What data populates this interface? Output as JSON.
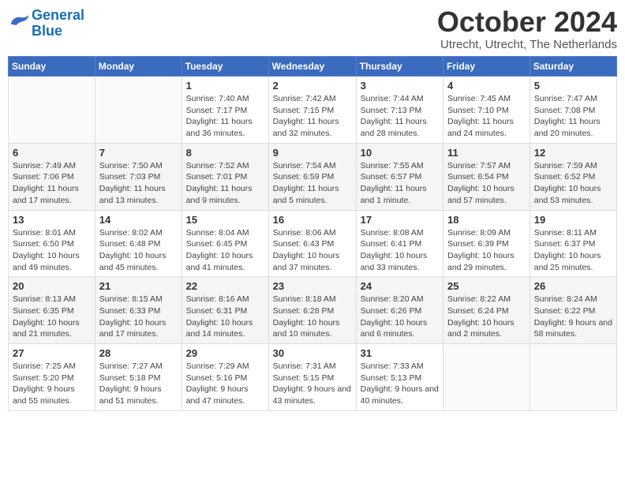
{
  "header": {
    "logo_line1": "General",
    "logo_line2": "Blue",
    "month": "October 2024",
    "location": "Utrecht, Utrecht, The Netherlands"
  },
  "days_of_week": [
    "Sunday",
    "Monday",
    "Tuesday",
    "Wednesday",
    "Thursday",
    "Friday",
    "Saturday"
  ],
  "weeks": [
    [
      {
        "num": "",
        "detail": ""
      },
      {
        "num": "",
        "detail": ""
      },
      {
        "num": "1",
        "detail": "Sunrise: 7:40 AM\nSunset: 7:17 PM\nDaylight: 11 hours and 36 minutes."
      },
      {
        "num": "2",
        "detail": "Sunrise: 7:42 AM\nSunset: 7:15 PM\nDaylight: 11 hours and 32 minutes."
      },
      {
        "num": "3",
        "detail": "Sunrise: 7:44 AM\nSunset: 7:13 PM\nDaylight: 11 hours and 28 minutes."
      },
      {
        "num": "4",
        "detail": "Sunrise: 7:45 AM\nSunset: 7:10 PM\nDaylight: 11 hours and 24 minutes."
      },
      {
        "num": "5",
        "detail": "Sunrise: 7:47 AM\nSunset: 7:08 PM\nDaylight: 11 hours and 20 minutes."
      }
    ],
    [
      {
        "num": "6",
        "detail": "Sunrise: 7:49 AM\nSunset: 7:06 PM\nDaylight: 11 hours and 17 minutes."
      },
      {
        "num": "7",
        "detail": "Sunrise: 7:50 AM\nSunset: 7:03 PM\nDaylight: 11 hours and 13 minutes."
      },
      {
        "num": "8",
        "detail": "Sunrise: 7:52 AM\nSunset: 7:01 PM\nDaylight: 11 hours and 9 minutes."
      },
      {
        "num": "9",
        "detail": "Sunrise: 7:54 AM\nSunset: 6:59 PM\nDaylight: 11 hours and 5 minutes."
      },
      {
        "num": "10",
        "detail": "Sunrise: 7:55 AM\nSunset: 6:57 PM\nDaylight: 11 hours and 1 minute."
      },
      {
        "num": "11",
        "detail": "Sunrise: 7:57 AM\nSunset: 6:54 PM\nDaylight: 10 hours and 57 minutes."
      },
      {
        "num": "12",
        "detail": "Sunrise: 7:59 AM\nSunset: 6:52 PM\nDaylight: 10 hours and 53 minutes."
      }
    ],
    [
      {
        "num": "13",
        "detail": "Sunrise: 8:01 AM\nSunset: 6:50 PM\nDaylight: 10 hours and 49 minutes."
      },
      {
        "num": "14",
        "detail": "Sunrise: 8:02 AM\nSunset: 6:48 PM\nDaylight: 10 hours and 45 minutes."
      },
      {
        "num": "15",
        "detail": "Sunrise: 8:04 AM\nSunset: 6:45 PM\nDaylight: 10 hours and 41 minutes."
      },
      {
        "num": "16",
        "detail": "Sunrise: 8:06 AM\nSunset: 6:43 PM\nDaylight: 10 hours and 37 minutes."
      },
      {
        "num": "17",
        "detail": "Sunrise: 8:08 AM\nSunset: 6:41 PM\nDaylight: 10 hours and 33 minutes."
      },
      {
        "num": "18",
        "detail": "Sunrise: 8:09 AM\nSunset: 6:39 PM\nDaylight: 10 hours and 29 minutes."
      },
      {
        "num": "19",
        "detail": "Sunrise: 8:11 AM\nSunset: 6:37 PM\nDaylight: 10 hours and 25 minutes."
      }
    ],
    [
      {
        "num": "20",
        "detail": "Sunrise: 8:13 AM\nSunset: 6:35 PM\nDaylight: 10 hours and 21 minutes."
      },
      {
        "num": "21",
        "detail": "Sunrise: 8:15 AM\nSunset: 6:33 PM\nDaylight: 10 hours and 17 minutes."
      },
      {
        "num": "22",
        "detail": "Sunrise: 8:16 AM\nSunset: 6:31 PM\nDaylight: 10 hours and 14 minutes."
      },
      {
        "num": "23",
        "detail": "Sunrise: 8:18 AM\nSunset: 6:28 PM\nDaylight: 10 hours and 10 minutes."
      },
      {
        "num": "24",
        "detail": "Sunrise: 8:20 AM\nSunset: 6:26 PM\nDaylight: 10 hours and 6 minutes."
      },
      {
        "num": "25",
        "detail": "Sunrise: 8:22 AM\nSunset: 6:24 PM\nDaylight: 10 hours and 2 minutes."
      },
      {
        "num": "26",
        "detail": "Sunrise: 8:24 AM\nSunset: 6:22 PM\nDaylight: 9 hours and 58 minutes."
      }
    ],
    [
      {
        "num": "27",
        "detail": "Sunrise: 7:25 AM\nSunset: 5:20 PM\nDaylight: 9 hours and 55 minutes."
      },
      {
        "num": "28",
        "detail": "Sunrise: 7:27 AM\nSunset: 5:18 PM\nDaylight: 9 hours and 51 minutes."
      },
      {
        "num": "29",
        "detail": "Sunrise: 7:29 AM\nSunset: 5:16 PM\nDaylight: 9 hours and 47 minutes."
      },
      {
        "num": "30",
        "detail": "Sunrise: 7:31 AM\nSunset: 5:15 PM\nDaylight: 9 hours and 43 minutes."
      },
      {
        "num": "31",
        "detail": "Sunrise: 7:33 AM\nSunset: 5:13 PM\nDaylight: 9 hours and 40 minutes."
      },
      {
        "num": "",
        "detail": ""
      },
      {
        "num": "",
        "detail": ""
      }
    ]
  ]
}
